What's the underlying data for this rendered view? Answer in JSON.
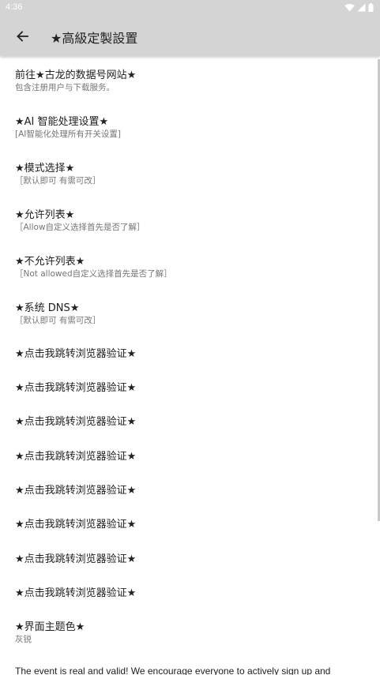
{
  "status_bar": {
    "time": "4:36"
  },
  "app_bar": {
    "title": "★高級定製設置"
  },
  "items": [
    {
      "title": "前往★古龙的数据号网站★",
      "summary": "包含注册用户与下载服务。"
    },
    {
      "title": "★AI 智能处理设置★",
      "summary": "[AI智能化处理所有开关设置]"
    },
    {
      "title": "★模式选择★",
      "summary": "［默认即可 有需可改］"
    },
    {
      "title": "★允许列表★",
      "summary": "［Allow自定义选择首先是否了解］"
    },
    {
      "title": "★不允许列表★",
      "summary": "［Not allowed自定义选择首先是否了解］"
    },
    {
      "title": "★系统 DNS★",
      "summary": "［默认即可 有需可改］"
    },
    {
      "title": "★点击我跳转浏览器验证★"
    },
    {
      "title": "★点击我跳转浏览器验证★"
    },
    {
      "title": "★点击我跳转浏览器验证★"
    },
    {
      "title": "★点击我跳转浏览器验证★"
    },
    {
      "title": "★点击我跳转浏览器验证★"
    },
    {
      "title": "★点击我跳转浏览器验证★"
    },
    {
      "title": "★点击我跳转浏览器验证★"
    },
    {
      "title": "★点击我跳转浏览器验证★"
    },
    {
      "title": "★界面主题色★",
      "summary": "灰锐"
    }
  ],
  "footer": {
    "text": "The event is real and valid! We encourage everyone to actively sign up and"
  },
  "colors": {
    "app_bar_bg": "#d4d4d4",
    "title_text": "#212121",
    "summary_text": "#757575"
  }
}
